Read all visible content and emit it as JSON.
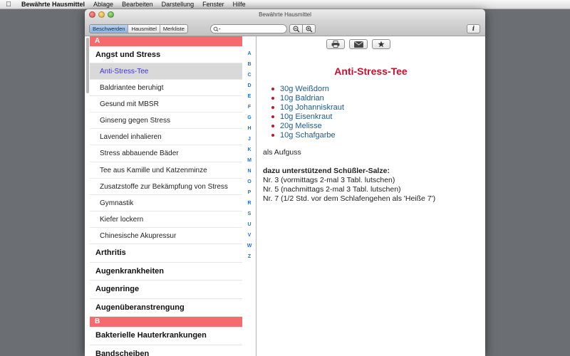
{
  "menubar": {
    "app_name": "Bewährte Hausmittel",
    "items": [
      "Ablage",
      "Bearbeiten",
      "Darstellung",
      "Fenster",
      "Hilfe"
    ]
  },
  "window": {
    "title": "Bewährte Hausmittel"
  },
  "toolbar": {
    "tabs": [
      "Beschwerden",
      "Hausmittel",
      "Merkliste"
    ],
    "search_value": ""
  },
  "sidebar": {
    "sections": [
      {
        "letter": "A"
      },
      {
        "letter": "B"
      }
    ],
    "categories": [
      "Angst und Stress",
      "Arthritis",
      "Augenkrankheiten",
      "Augenringe",
      "Augenüberanstrengung",
      "Bakterielle Hauterkrankungen",
      "Bandscheiben"
    ],
    "subitems": [
      "Anti-Stress-Tee",
      "Baldriantee beruhigt",
      "Gesund mit MBSR",
      "Ginseng gegen Stress",
      "Lavendel inhalieren",
      "Stress abbauende Bäder",
      "Tee aus Kamille und Katzenminze",
      "Zusatzstoffe zur Bekämpfung von Stress",
      "Gymnastik",
      "Kiefer lockern",
      "Chinesische Akupressur"
    ],
    "alphabet": [
      "A",
      "B",
      "C",
      "D",
      "E",
      "F",
      "G",
      "H",
      "J",
      "K",
      "M",
      "N",
      "O",
      "P",
      "R",
      "S",
      "U",
      "V",
      "W",
      "Z"
    ]
  },
  "detail": {
    "title": "Anti-Stress-Tee",
    "ingredients": [
      "30g Weißdorn",
      "10g Baldrian",
      "10g Johanniskraut",
      "10g Eisenkraut",
      "20g Melisse",
      "10g Schafgarbe"
    ],
    "preparation": "als Aufguss",
    "salts_heading": "dazu unterstützend Schüßler-Salze:",
    "salts": [
      "Nr. 3 (vormittags 2-mal 3 Tabl. lutschen)",
      "Nr. 5 (nachmittags 2-mal 3 Tabl. lutschen)",
      "Nr. 7 (1/2 Std. vor dem Schlafengehen als 'Heiße 7')"
    ]
  }
}
